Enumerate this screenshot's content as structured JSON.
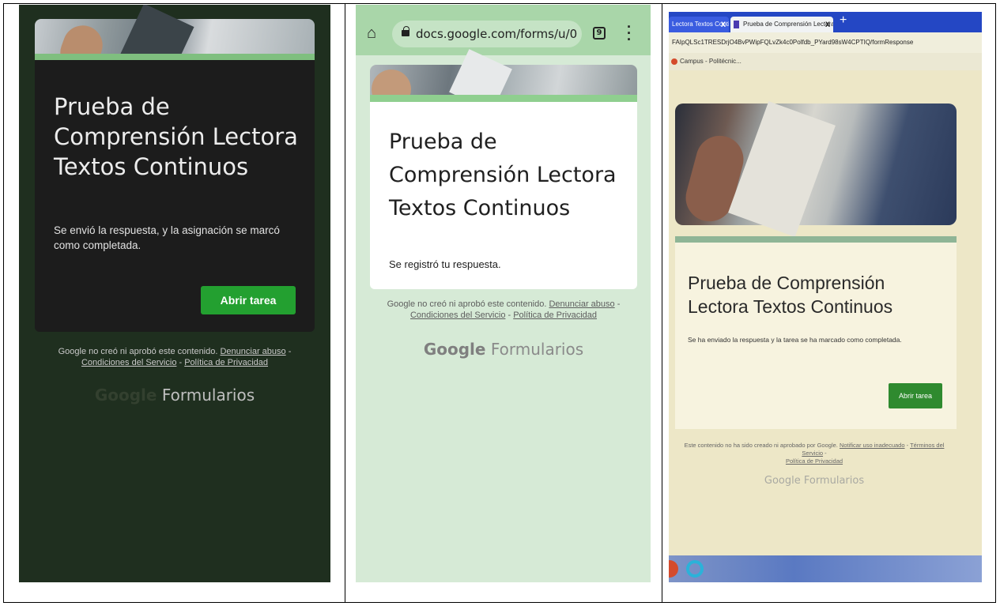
{
  "panel1": {
    "title": "Prueba de Comprensión Lectora Textos Continuos",
    "message": "Se envió la respuesta, y la asignación se marcó como completada.",
    "button": "Abrir tarea",
    "footer": {
      "notice": "Google no creó ni aprobó este contenido.",
      "link_abuse": "Denunciar abuso",
      "sep1": " -",
      "link_terms": "Condiciones del Servicio",
      "sep2": " - ",
      "link_privacy": "Política de Privacidad"
    },
    "brand_google": "Google",
    "brand_forms": "Formularios"
  },
  "panel2": {
    "url": "docs.google.com/forms/u/0",
    "tab_count": "9",
    "title": "Prueba de Comprensión Lectora Textos Continuos",
    "message": "Se registró tu respuesta.",
    "footer": {
      "notice": "Google no creó ni aprobó este contenido.",
      "link_abuse": "Denunciar abuso",
      "sep1": " -",
      "link_terms": "Condiciones del Servicio",
      "sep2": " - ",
      "link_privacy": "Política de Privacidad"
    },
    "brand_google": "Google",
    "brand_forms": "Formularios"
  },
  "panel3": {
    "tab1": "Lectora Textos Conti",
    "tab2": "Prueba de Comprensión Lectora",
    "close": "X",
    "newtab": "+",
    "address": "FAIpQLSc1TRESDrjO4BvPWipFQLvZk4c0Polfdb_PYard98sW4CPTIQ/formResponse",
    "bookmark": "Campus - Politécnic...",
    "title": "Prueba de Comprensión Lectora Textos Continuos",
    "message": "Se ha enviado la respuesta y la tarea se ha marcado como completada.",
    "button": "Abrir tarea",
    "footer": {
      "notice": "Este contenido no ha sido creado ni aprobado por Google.",
      "link_report": "Notificar uso inadecuado",
      "sep1": " - ",
      "link_terms": "Términos del Servicio",
      "sep2": " - ",
      "link_privacy": "Política de Privacidad"
    },
    "brand": "Google Formularios"
  },
  "colors": {
    "p1_bg": "#1f2f1f",
    "p1_card": "#1c1c1c",
    "p1_button": "#23a030",
    "p2_bg": "#d6ead6",
    "p2_toolbar": "#a9d6a9",
    "p3_tabbar": "#2447c4",
    "p3_button": "#2f8a2f",
    "accent_green": "#8fcf8f"
  },
  "icons": [
    "home-icon",
    "lock-icon",
    "tabs-counter-icon",
    "menu-dots-icon",
    "forms-tab-icon",
    "start-icon",
    "edge-icon"
  ]
}
